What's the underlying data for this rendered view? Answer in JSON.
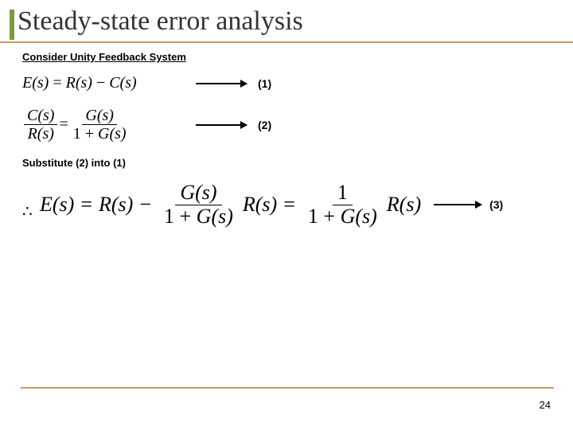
{
  "title": "Steady-state error analysis",
  "subheading": "Consider Unity Feedback System",
  "equations": {
    "eq1_lhs": "E(s)",
    "eq1_eq": " = ",
    "eq1_r": "R(s)",
    "eq1_minus": " − ",
    "eq1_c": "C(s)",
    "eq1_tag": "(1)",
    "eq2_lhs_num": "C(s)",
    "eq2_lhs_den": "R(s)",
    "eq2_eq": " = ",
    "eq2_rhs_num": "G(s)",
    "eq2_rhs_den_pre": "1 + ",
    "eq2_rhs_den_g": "G(s)",
    "eq2_tag": "(2)"
  },
  "substitute": "Substitute (2) into (1)",
  "eq3": {
    "lhs": "E(s)",
    "eq": " = ",
    "r": "R(s)",
    "minus": " − ",
    "f1_num": "G(s)",
    "f1_den_pre": "1 + ",
    "f1_den_g": "G(s)",
    "r2": "R(s)",
    "eq2": " = ",
    "f2_num": "1",
    "f2_den_pre": "1 + ",
    "f2_den_g": "G(s)",
    "r3": "R(s)",
    "tag": "(3)"
  },
  "page_number": "24"
}
